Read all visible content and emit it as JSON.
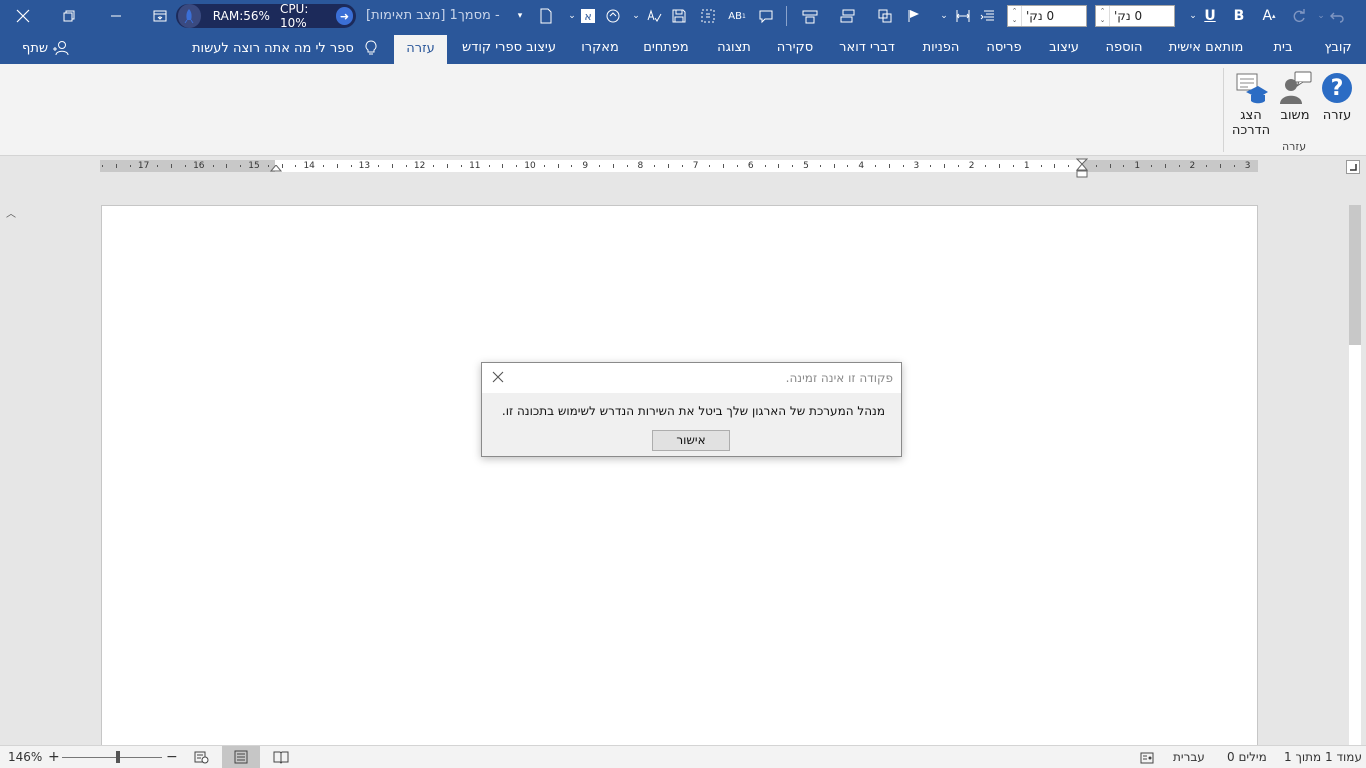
{
  "titlebar": {
    "doc_title": "מסמך1 [מצב תאימות] -",
    "ram": "RAM:56%",
    "cpu": "CPU: 10%",
    "spin1_value": "0 נק'",
    "spin2_value": "0 נק'",
    "bold_label": "B",
    "underline_label": "U",
    "abc_label": "AB",
    "font_a_label": "A"
  },
  "tabs": [
    "קובץ",
    "בית",
    "מותאם אישית",
    "הוספה",
    "עיצוב",
    "פריסה",
    "הפניות",
    "דברי דואר",
    "סקירה",
    "תצוגה",
    "מפתחים",
    "מאקרו",
    "עיצוב ספרי קודש",
    "עזרה"
  ],
  "active_tab": "עזרה",
  "tell_me": "ספר לי מה אתה רוצה לעשות",
  "share": "שתף",
  "ribbon": {
    "help": "עזרה",
    "feedback": "משוב",
    "training_line1": "הצג",
    "training_line2": "הדרכה",
    "group_label": "עזרה"
  },
  "ruler": {
    "numbers_left": [
      "17",
      "16",
      "15",
      "14",
      "13",
      "12",
      "11",
      "10",
      "9",
      "8",
      "7",
      "6",
      "5",
      "4",
      "3",
      "2",
      "1"
    ],
    "numbers_right": [
      "1",
      "2",
      "3"
    ]
  },
  "dialog": {
    "title": "פקודה זו אינה זמינה.",
    "message": "מנהל המערכת של הארגון שלך ביטל את השירות הנדרש לשימוש בתכונה זו.",
    "ok_label": "אישור"
  },
  "statusbar": {
    "page": "עמוד 1 מתוך 1",
    "words": "0 מילים",
    "language": "עברית",
    "zoom": "146%",
    "zoom_percent": 146
  },
  "colors": {
    "ribbon_blue": "#2b579a",
    "ribbon_bg": "#f3f3f3",
    "help_icon_blue": "#2b6cc4"
  }
}
